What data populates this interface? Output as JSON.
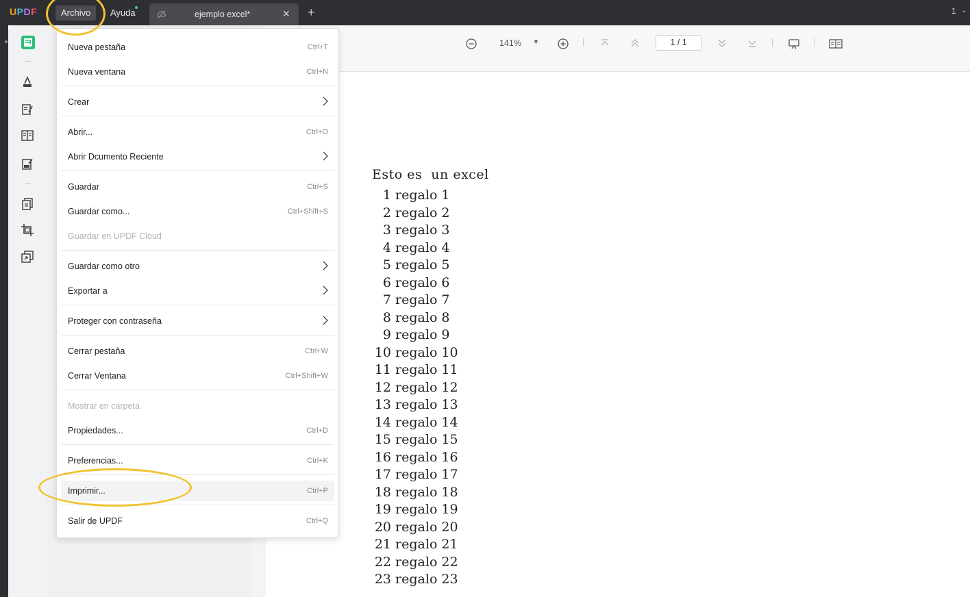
{
  "app": {
    "logo": "UPDF",
    "menus": [
      "Archivo",
      "Ayuda"
    ],
    "tab_title": "ejemplo excel*",
    "window_number": "1"
  },
  "toolbar": {
    "zoom": "141%",
    "page": "1 / 1"
  },
  "file_menu": {
    "items": [
      {
        "label": "Nueva pestaña",
        "shortcut": "Ctrl+T"
      },
      {
        "label": "Nueva ventana",
        "shortcut": "Ctrl+N"
      },
      {
        "label": "Crear",
        "shortcut": ""
      },
      {
        "label": "Abrir...",
        "shortcut": "Ctrl+O"
      },
      {
        "label": "Abrir Dcumento Reciente",
        "shortcut": ""
      },
      {
        "label": "Guardar",
        "shortcut": "Ctrl+S"
      },
      {
        "label": "Guardar como...",
        "shortcut": "Ctrl+Shift+S"
      },
      {
        "label": "Guardar en UPDF Cloud",
        "shortcut": ""
      },
      {
        "label": "Guardar como otro",
        "shortcut": ""
      },
      {
        "label": "Exportar a",
        "shortcut": ""
      },
      {
        "label": "Proteger con contraseña",
        "shortcut": ""
      },
      {
        "label": "Cerrar pestaña",
        "shortcut": "Ctrl+W"
      },
      {
        "label": "Cerrar Ventana",
        "shortcut": "Ctrl+Shift+W"
      },
      {
        "label": "Mostrar en carpeta",
        "shortcut": ""
      },
      {
        "label": "Propiedades...",
        "shortcut": "Ctrl+D"
      },
      {
        "label": "Preferencias...",
        "shortcut": "Ctrl+K"
      },
      {
        "label": "Imprimir...",
        "shortcut": "Ctrl+P"
      },
      {
        "label": "Salir de UPDF",
        "shortcut": "Ctrl+Q"
      }
    ]
  },
  "document": {
    "heading": "Esto es  un excel",
    "rows": [
      {
        "num": "1",
        "text": "regalo 1"
      },
      {
        "num": "2",
        "text": "regalo 2"
      },
      {
        "num": "3",
        "text": "regalo 3"
      },
      {
        "num": "4",
        "text": "regalo 4"
      },
      {
        "num": "5",
        "text": "regalo 5"
      },
      {
        "num": "6",
        "text": "regalo 6"
      },
      {
        "num": "7",
        "text": "regalo 7"
      },
      {
        "num": "8",
        "text": "regalo 8"
      },
      {
        "num": "9",
        "text": "regalo 9"
      },
      {
        "num": "10",
        "text": "regalo 10"
      },
      {
        "num": "11",
        "text": "regalo 11"
      },
      {
        "num": "12",
        "text": "regalo 12"
      },
      {
        "num": "13",
        "text": "regalo 13"
      },
      {
        "num": "14",
        "text": "regalo 14"
      },
      {
        "num": "15",
        "text": "regalo 15"
      },
      {
        "num": "16",
        "text": "regalo 16"
      },
      {
        "num": "17",
        "text": "regalo 17"
      },
      {
        "num": "18",
        "text": "regalo 18"
      },
      {
        "num": "19",
        "text": "regalo 19"
      },
      {
        "num": "20",
        "text": "regalo 20"
      },
      {
        "num": "21",
        "text": "regalo 21"
      },
      {
        "num": "22",
        "text": "regalo 22"
      },
      {
        "num": "23",
        "text": "regalo 23"
      }
    ]
  },
  "colors": {
    "titlebar": "#2e2f33",
    "accent_green": "#2bbf7a",
    "annotation_yellow": "#f2c230"
  },
  "icons": [
    "reader-icon",
    "comment-icon",
    "edit-icon",
    "organize-icon",
    "form-icon",
    "pages-icon",
    "crop-icon",
    "compress-icon",
    "zoom-out-icon",
    "zoom-in-icon",
    "first-page-icon",
    "prev-page-icon",
    "next-page-icon",
    "last-page-icon",
    "presentation-icon",
    "page-layout-icon"
  ]
}
